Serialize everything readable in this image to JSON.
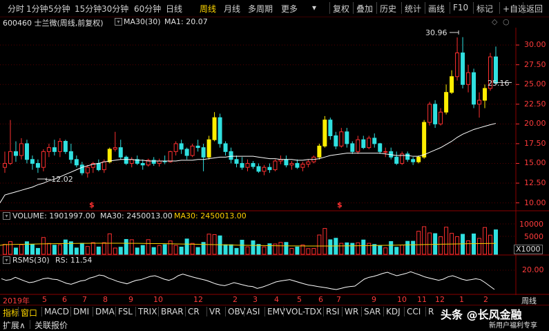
{
  "toolbar": {
    "tabs": [
      "分时",
      "1分钟",
      "5分钟",
      "15分钟",
      "30分钟",
      "60分钟",
      "日线",
      "周线",
      "月线",
      "多周期",
      "更多"
    ],
    "active_tab": "周线",
    "right_buttons": [
      "复权",
      "叠加",
      "历史",
      "统计",
      "画线",
      "F10",
      "标记",
      "+自选",
      "返回"
    ]
  },
  "info": {
    "code_name": "600460 士兰微(周线,前复权)",
    "ma30": "MA30(30)",
    "ma1": "MA1: 20.07"
  },
  "price_axis": [
    "30.00",
    "27.50",
    "25.00",
    "22.50",
    "20.00",
    "17.50",
    "15.00",
    "12.50",
    "10.00"
  ],
  "price_annotations": {
    "high": "30.96",
    "low": "12.02",
    "last": "25.16"
  },
  "volume_panel": {
    "title": "VOLUME: 1901997.00",
    "ma30_a": "MA30: 2450013.00",
    "ma30_b": "MA30: 2450013.00",
    "axis": [
      "10000",
      "5000"
    ],
    "unit": "X1000"
  },
  "rsms_panel": {
    "title": "RSMS(30)",
    "rs": "RS: 11.54",
    "axis": [
      "20.00"
    ]
  },
  "date_axis": {
    "labels": [
      "2019年",
      "5",
      "6",
      "7",
      "8",
      "9",
      "10",
      "12",
      "2",
      "3",
      "4",
      "5",
      "6",
      "7",
      "9",
      "10",
      "11",
      "12",
      "1",
      "2"
    ],
    "period": "周线"
  },
  "indicator_tabs": [
    "指标",
    "窗口",
    "MACD",
    "DMI",
    "DMA",
    "FSL",
    "TRIX",
    "BRAR",
    "CR",
    "VR",
    "OBV",
    "ASI",
    "EMV",
    "VOL-TDX",
    "RSI",
    "WR",
    "SAR",
    "KDJ",
    "CCI",
    "R"
  ],
  "bottom_row": [
    "扩展∧",
    "关联报价"
  ],
  "watermark": {
    "main": "头条 @长风金融",
    "sub": "新用户福利专享"
  },
  "colors": {
    "up": "#ff3030",
    "down": "#30e0e0",
    "limit": "#ffee00",
    "ma": "#ffffff",
    "vol_ma": "#ffd000",
    "grid": "#5a0000"
  },
  "chart_data": {
    "type": "candlestick",
    "title": "600460 士兰微(周线,前复权)",
    "ylim": [
      9,
      31.5
    ],
    "ohlc": [
      [
        14.5,
        16.5,
        13.8,
        15.0
      ],
      [
        15.0,
        20.5,
        14.8,
        16.5
      ],
      [
        16.5,
        17.8,
        15.2,
        16.0
      ],
      [
        16.0,
        18.2,
        15.5,
        17.5
      ],
      [
        17.5,
        18.0,
        15.0,
        15.5
      ],
      [
        15.5,
        16.0,
        14.2,
        15.0
      ],
      [
        15.0,
        15.5,
        13.8,
        14.5
      ],
      [
        14.5,
        16.8,
        14.0,
        16.5
      ],
      [
        16.5,
        17.5,
        15.8,
        17.0
      ],
      [
        17.0,
        18.0,
        16.0,
        16.5
      ],
      [
        16.5,
        18.2,
        15.8,
        17.8
      ],
      [
        17.8,
        18.0,
        16.2,
        16.5
      ],
      [
        16.5,
        17.5,
        15.0,
        15.5
      ],
      [
        15.5,
        16.0,
        14.5,
        14.8
      ],
      [
        14.8,
        15.2,
        13.5,
        13.8
      ],
      [
        13.8,
        14.8,
        13.2,
        14.5
      ],
      [
        14.5,
        15.2,
        13.8,
        15.0
      ],
      [
        15.0,
        15.5,
        14.0,
        14.2
      ],
      [
        14.2,
        15.5,
        13.8,
        15.2
      ],
      [
        15.2,
        17.0,
        15.0,
        16.8
      ],
      [
        16.8,
        19.0,
        16.5,
        17.0
      ],
      [
        17.0,
        18.0,
        15.5,
        15.8
      ],
      [
        15.8,
        16.0,
        14.8,
        15.0
      ],
      [
        15.0,
        15.8,
        14.5,
        15.5
      ],
      [
        15.5,
        16.0,
        14.8,
        15.0
      ],
      [
        15.0,
        15.5,
        14.2,
        14.8
      ],
      [
        14.8,
        15.6,
        14.6,
        15.4
      ],
      [
        15.4,
        15.8,
        14.7,
        15.0
      ],
      [
        15.0,
        15.6,
        14.6,
        15.3
      ],
      [
        15.3,
        16.0,
        14.9,
        15.2
      ],
      [
        15.2,
        16.6,
        15.1,
        16.5
      ],
      [
        16.5,
        17.8,
        16.0,
        17.5
      ],
      [
        17.5,
        18.0,
        16.2,
        16.8
      ],
      [
        16.8,
        17.0,
        15.5,
        16.0
      ],
      [
        16.0,
        17.5,
        15.8,
        17.2
      ],
      [
        17.2,
        18.0,
        16.5,
        17.0
      ],
      [
        17.0,
        17.5,
        14.0,
        15.8
      ],
      [
        15.8,
        18.5,
        15.5,
        18.0
      ],
      [
        18.0,
        21.5,
        17.8,
        20.8
      ],
      [
        20.8,
        21.3,
        17.0,
        17.5
      ],
      [
        17.5,
        17.8,
        16.0,
        16.5
      ],
      [
        16.5,
        17.0,
        15.0,
        15.5
      ],
      [
        15.5,
        16.0,
        14.5,
        15.0
      ],
      [
        15.0,
        15.8,
        14.2,
        14.5
      ],
      [
        14.5,
        15.5,
        14.0,
        15.0
      ],
      [
        15.0,
        15.3,
        14.3,
        14.6
      ],
      [
        14.6,
        15.0,
        13.8,
        14.0
      ],
      [
        14.0,
        14.8,
        13.5,
        14.5
      ],
      [
        14.5,
        15.0,
        13.8,
        14.2
      ],
      [
        14.2,
        15.5,
        14.0,
        15.3
      ],
      [
        15.3,
        16.0,
        14.9,
        15.5
      ],
      [
        15.5,
        16.0,
        14.5,
        14.8
      ],
      [
        14.8,
        15.3,
        14.2,
        15.0
      ],
      [
        15.0,
        15.5,
        14.3,
        14.5
      ],
      [
        14.5,
        15.2,
        14.0,
        14.9
      ],
      [
        14.9,
        15.5,
        14.5,
        15.2
      ],
      [
        15.2,
        16.0,
        15.0,
        15.8
      ],
      [
        15.8,
        17.5,
        15.5,
        17.2
      ],
      [
        17.2,
        21.0,
        17.0,
        20.5
      ],
      [
        20.5,
        20.8,
        18.0,
        18.5
      ],
      [
        18.5,
        19.0,
        16.8,
        17.2
      ],
      [
        17.2,
        19.5,
        17.0,
        19.0
      ],
      [
        19.0,
        19.5,
        17.0,
        17.5
      ],
      [
        17.5,
        17.8,
        16.2,
        16.5
      ],
      [
        16.5,
        18.5,
        16.2,
        18.0
      ],
      [
        18.0,
        18.5,
        16.8,
        17.0
      ],
      [
        17.0,
        18.5,
        16.8,
        18.2
      ],
      [
        18.2,
        18.8,
        17.0,
        17.5
      ],
      [
        17.5,
        17.6,
        16.2,
        16.5
      ],
      [
        16.5,
        17.0,
        15.8,
        16.5
      ],
      [
        16.5,
        17.0,
        15.5,
        15.8
      ],
      [
        15.8,
        16.5,
        14.8,
        15.0
      ],
      [
        15.0,
        16.5,
        14.8,
        16.2
      ],
      [
        16.2,
        16.5,
        15.2,
        15.5
      ],
      [
        15.5,
        15.8,
        14.8,
        15.2
      ],
      [
        15.2,
        16.0,
        15.0,
        15.8
      ],
      [
        15.8,
        20.5,
        15.6,
        20.2
      ],
      [
        20.2,
        22.8,
        19.8,
        22.5
      ],
      [
        22.5,
        23.0,
        19.5,
        20.0
      ],
      [
        20.0,
        22.0,
        19.8,
        21.5
      ],
      [
        21.5,
        25.0,
        21.2,
        24.0
      ],
      [
        24.0,
        26.8,
        23.8,
        26.0
      ],
      [
        26.0,
        30.96,
        25.5,
        29.0
      ],
      [
        29.0,
        31.0,
        24.5,
        25.0
      ],
      [
        25.0,
        27.5,
        24.0,
        26.5
      ],
      [
        26.5,
        27.0,
        22.0,
        22.5
      ],
      [
        22.5,
        24.0,
        20.8,
        23.0
      ],
      [
        23.0,
        25.0,
        22.0,
        24.5
      ],
      [
        24.5,
        29.0,
        24.2,
        28.5
      ],
      [
        28.5,
        29.8,
        25.0,
        25.16
      ]
    ],
    "limit_up_weeks": [
      19,
      37,
      38,
      57,
      58,
      75,
      76,
      80,
      81,
      87
    ],
    "ma30": [
      11.0,
      11.2,
      11.4,
      11.6,
      11.8,
      12.0,
      12.3,
      12.5,
      12.8,
      13.0,
      13.3,
      13.6,
      13.9,
      14.2,
      14.5,
      14.7,
      14.9,
      15.0,
      15.2,
      15.3,
      15.4,
      15.5,
      15.5,
      15.5,
      15.4,
      15.4,
      15.3,
      15.3,
      15.3,
      15.3,
      15.3,
      15.3,
      15.4,
      15.4,
      15.4,
      15.5,
      15.5,
      15.6,
      15.7,
      15.8,
      15.8,
      15.9,
      15.9,
      15.9,
      15.9,
      15.9,
      15.8,
      15.7,
      15.6,
      15.6,
      15.5,
      15.5,
      15.5,
      15.4,
      15.4,
      15.5,
      15.5,
      15.6,
      15.8,
      16.0,
      16.1,
      16.2,
      16.3,
      16.3,
      16.3,
      16.3,
      16.3,
      16.3,
      16.3,
      16.2,
      16.1,
      16.0,
      16.0,
      16.0,
      15.9,
      15.9,
      16.1,
      16.4,
      16.7,
      17.0,
      17.4,
      17.8,
      18.3,
      18.7,
      19.0,
      19.3,
      19.5,
      19.7,
      19.9,
      20.07
    ],
    "rsms": [
      16.2,
      15.5,
      15.8,
      16.8,
      16.0,
      15.2,
      14.5,
      14.8,
      15.5,
      16.2,
      16.5,
      16.0,
      15.8,
      15.0,
      14.2,
      13.8,
      14.5,
      15.2,
      15.5,
      16.5,
      17.0,
      17.8,
      17.5,
      16.5,
      15.8,
      15.0,
      14.5,
      14.0,
      14.8,
      15.5,
      15.8,
      16.5,
      17.2,
      17.5,
      16.8,
      16.0,
      15.5,
      16.2,
      17.5,
      18.2,
      17.6,
      17.0,
      16.5,
      16.0,
      15.5,
      14.8,
      14.0,
      13.5,
      13.2,
      13.8,
      14.5,
      14.0,
      13.5,
      13.0,
      12.8,
      12.0,
      12.5,
      13.2,
      14.0,
      14.8,
      15.2,
      15.5,
      15.8,
      15.2,
      14.6,
      14.0,
      13.5,
      13.2,
      12.8,
      12.5,
      12.2,
      11.8,
      11.5,
      12.0,
      12.5,
      12.8,
      13.0,
      14.5,
      16.0,
      16.8,
      17.2,
      17.8,
      18.5,
      19.0,
      18.2,
      17.5,
      18.0,
      18.5,
      19.2,
      18.5,
      17.8,
      17.0,
      16.5,
      16.0,
      15.5,
      16.0,
      17.0,
      17.5,
      16.8,
      16.0,
      15.5,
      15.8,
      16.2,
      15.8,
      14.5,
      13.0,
      11.54
    ]
  }
}
